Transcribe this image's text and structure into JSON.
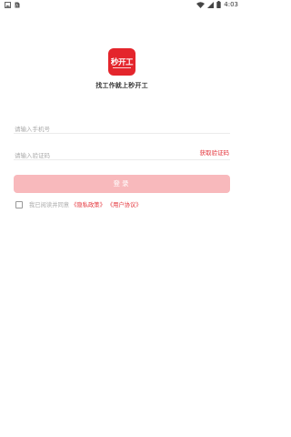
{
  "status_bar": {
    "time": "4:03",
    "left_icons": [
      "gallery-notification-icon",
      "sim-notification-icon"
    ],
    "right_icons": [
      "wifi-icon",
      "signal-icon",
      "battery-icon"
    ]
  },
  "app": {
    "logo_text": "秒开工",
    "tagline": "找工作就上秒开工",
    "brand_color": "#e4252c"
  },
  "login_form": {
    "phone_placeholder": "请输入手机号",
    "code_placeholder": "请输入验证码",
    "get_code_label": "获取验证码",
    "login_label": "登录",
    "login_button_color": "#f8b9bc"
  },
  "agreement": {
    "prefix": "我已阅读并同意",
    "privacy_link": "《隐私政策》",
    "terms_link": "《用户协议》"
  }
}
